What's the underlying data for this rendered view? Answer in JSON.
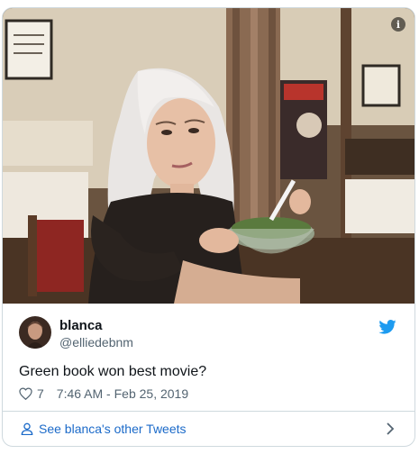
{
  "media": {
    "info_label": "i",
    "description": "Woman with platinum hair eating salad from a bowl in a trailer"
  },
  "tweet": {
    "display_name": "blanca",
    "handle": "@elliedebnm",
    "text": "Green book won best movie?",
    "likes": "7",
    "timestamp": "7:46 AM - Feb 25, 2019"
  },
  "footer": {
    "link_text": "See blanca's other Tweets"
  },
  "colors": {
    "brand_blue": "#1d9bf0",
    "link_blue": "#1b6ac9",
    "border": "#cfd9de",
    "muted_text": "#536471"
  },
  "icons": [
    "info-icon",
    "twitter-bird-icon",
    "heart-icon",
    "person-icon",
    "chevron-right-icon"
  ]
}
